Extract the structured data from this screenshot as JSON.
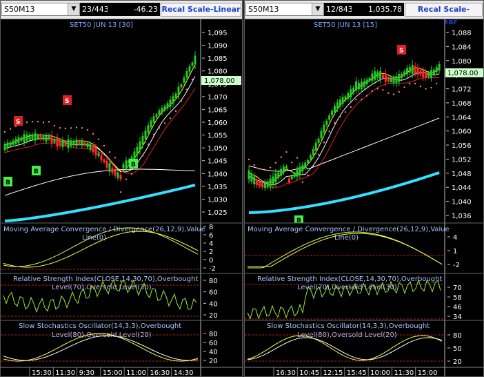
{
  "colors": {
    "up": "#22cc22",
    "down": "#ff2a2a",
    "sma_white": "#ffffff",
    "sma_cyan": "#33e0ff",
    "ma_yellow": "#ffff33",
    "ma_red": "#e02020",
    "psar": "#ff8a6a",
    "sell": "#e02020",
    "buy": "#44ee44"
  },
  "left": {
    "symbol": "S50M13",
    "counter": "23/443",
    "change": "-46.23",
    "scale_button": "Recal Scale-Linear",
    "chart_title": "SET50 JUN 13   [30]",
    "last_price": "1,078.00",
    "price_ticks": [
      "1,095",
      "1,090",
      "1,085",
      "1,080",
      "1,075",
      "1,070",
      "1,065",
      "1,060",
      "1,055",
      "1,050",
      "1,045",
      "1,040",
      "1,035",
      "1,030",
      "1,025"
    ],
    "macd_title_1": "Moving Average Convergence / Divergence(26,12,9),Value",
    "macd_title_2": "Line(0)",
    "macd_ticks": [
      "8",
      "6",
      "4",
      "2",
      "0",
      "-2"
    ],
    "rsi_title_1": "Relative Strength Index(CLOSE,14,30,70),Overbought",
    "rsi_title_2": "Level(70),Oversold Level(30)",
    "rsi_ticks": [
      "80",
      "60",
      "40",
      "20"
    ],
    "sto_title_1": "Slow Stochastics Oscillator(14,3,3),Overbought",
    "sto_title_2": "Level(80),Oversold Level(20)",
    "sto_ticks": [
      "80",
      "60",
      "40",
      "20"
    ],
    "time_labels": [
      "15:30",
      "11:30",
      "9:30",
      "15:00",
      "11:00",
      "16:30",
      "14:30"
    ],
    "signals": [
      "S",
      "S",
      "B",
      "B",
      "B"
    ]
  },
  "right": {
    "symbol": "S50M13",
    "counter": "12/843",
    "change": "1,035.78",
    "scale_button": "Recal Scale-Linear",
    "chart_title": "SET50 JUN 13   [15]",
    "last_price": "1,078.00",
    "price_ticks": [
      "1,088",
      "1,084",
      "1,080",
      "1,076",
      "1,072",
      "1,068",
      "1,064",
      "1,060",
      "1,056",
      "1,052",
      "1,048",
      "1,044",
      "1,040",
      "1,036"
    ],
    "macd_title_1": "Moving Average Convergence / Divergence(26,12,9),Value",
    "macd_title_2": "Line(0)",
    "macd_ticks": [
      "4",
      "1",
      "-2"
    ],
    "rsi_title_1": "Relative Strength Index(CLOSE,14,30,70),Overbought",
    "rsi_title_2": "Level(70),Oversold Level(30)",
    "rsi_ticks": [
      "70",
      "58",
      "46",
      "34"
    ],
    "sto_title_1": "Slow Stochastics Oscillator(14,3,3),Overbought",
    "sto_title_2": "Level(80),Oversold Level(20)",
    "sto_ticks": [
      "80",
      "50",
      "20"
    ],
    "time_labels": [
      "16:30",
      "10:45",
      "12:15",
      "15:45",
      "10:00",
      "11:30",
      "15:00"
    ],
    "signals": [
      "S",
      "B"
    ]
  }
}
